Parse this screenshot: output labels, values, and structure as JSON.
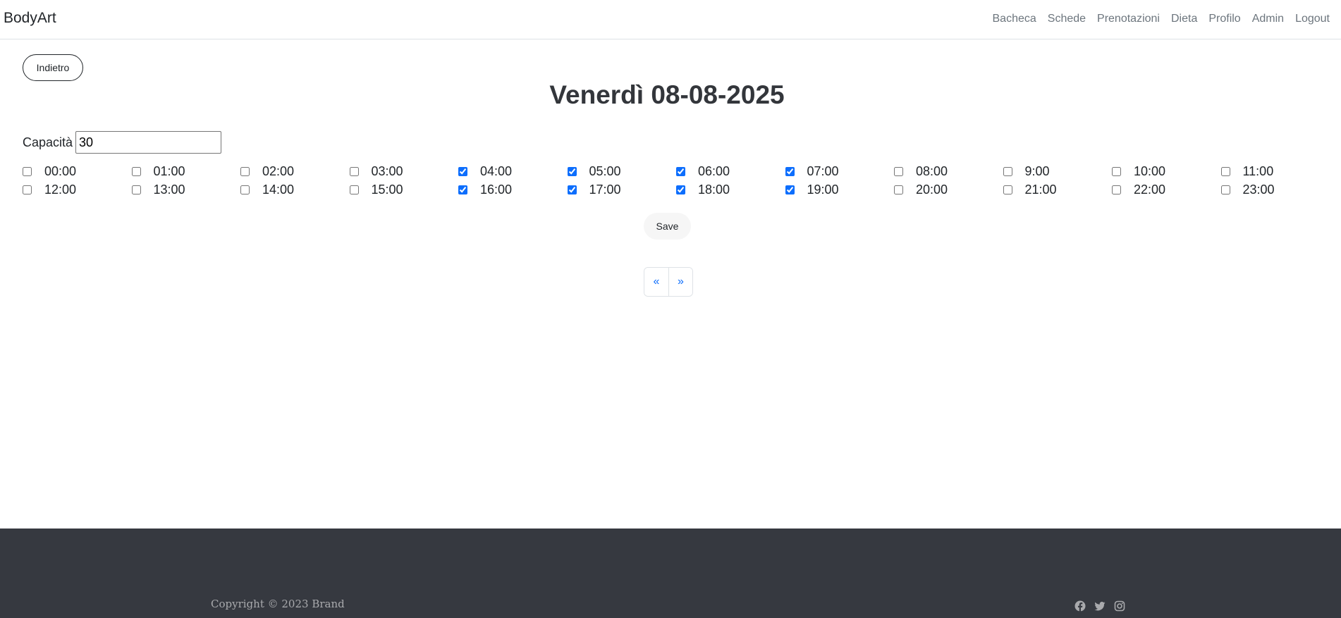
{
  "navbar": {
    "brand": "BodyArt",
    "links": [
      "Bacheca",
      "Schede",
      "Prenotazioni",
      "Dieta",
      "Profilo",
      "Admin",
      "Logout"
    ]
  },
  "back_button": "Indietro",
  "title": "Venerdì 08-08-2025",
  "capacity": {
    "label": "Capacità",
    "value": "30"
  },
  "hours": [
    {
      "label": "00:00",
      "checked": false
    },
    {
      "label": "01:00",
      "checked": false
    },
    {
      "label": "02:00",
      "checked": false
    },
    {
      "label": "03:00",
      "checked": false
    },
    {
      "label": "04:00",
      "checked": true
    },
    {
      "label": "05:00",
      "checked": true
    },
    {
      "label": "06:00",
      "checked": true
    },
    {
      "label": "07:00",
      "checked": true
    },
    {
      "label": "08:00",
      "checked": false
    },
    {
      "label": "9:00",
      "checked": false
    },
    {
      "label": "10:00",
      "checked": false
    },
    {
      "label": "11:00",
      "checked": false
    },
    {
      "label": "12:00",
      "checked": false
    },
    {
      "label": "13:00",
      "checked": false
    },
    {
      "label": "14:00",
      "checked": false
    },
    {
      "label": "15:00",
      "checked": false
    },
    {
      "label": "16:00",
      "checked": true
    },
    {
      "label": "17:00",
      "checked": true
    },
    {
      "label": "18:00",
      "checked": true
    },
    {
      "label": "19:00",
      "checked": true
    },
    {
      "label": "20:00",
      "checked": false
    },
    {
      "label": "21:00",
      "checked": false
    },
    {
      "label": "22:00",
      "checked": false
    },
    {
      "label": "23:00",
      "checked": false
    }
  ],
  "save_button": "Save",
  "pagination": {
    "prev": "«",
    "next": "»"
  },
  "footer": {
    "copyright": "Copyright © 2023 Brand",
    "socials": [
      "facebook-icon",
      "twitter-icon",
      "instagram-icon"
    ]
  },
  "colors": {
    "accent": "#0d6efd",
    "footer_bg": "#363940",
    "nav_link": "#6c757d"
  }
}
